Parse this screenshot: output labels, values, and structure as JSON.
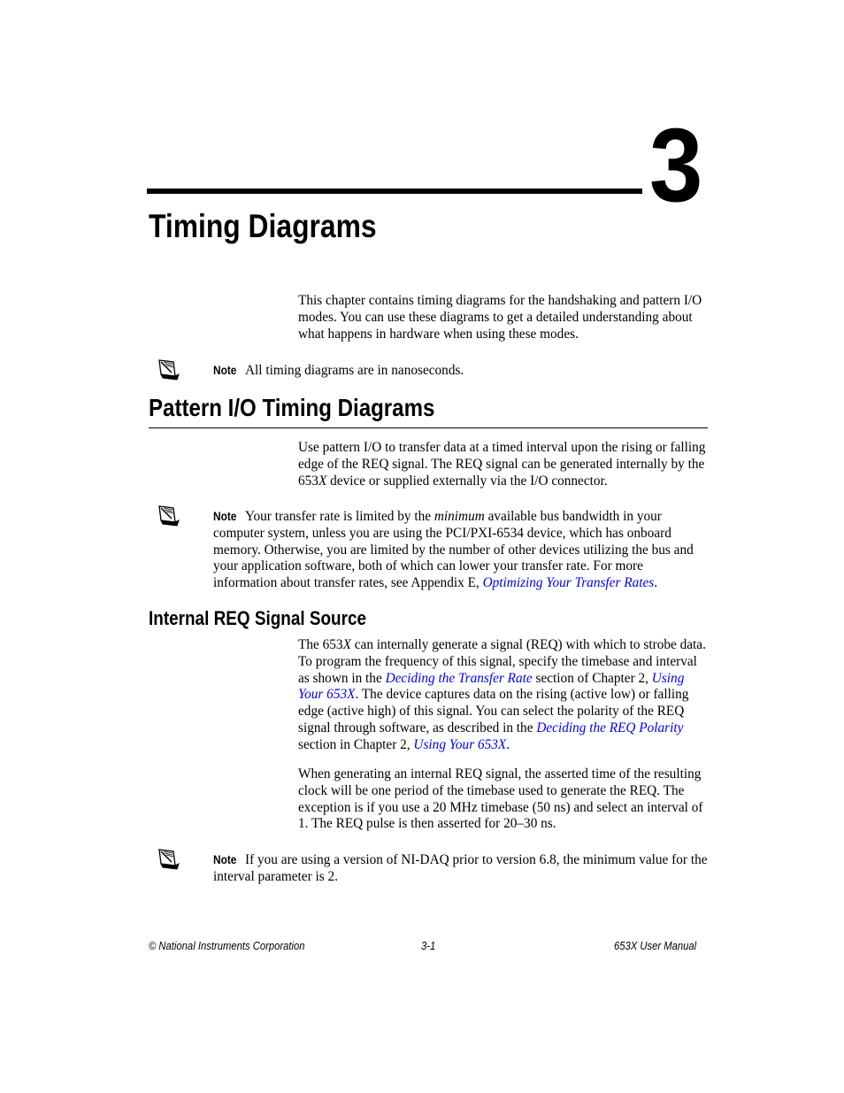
{
  "chapter": {
    "number": "3",
    "title": "Timing Diagrams"
  },
  "intro": {
    "paragraph": "This chapter contains timing diagrams for the handshaking and pattern I/O modes. You can use these diagrams to get a detailed understanding about what happens in hardware when using these modes."
  },
  "note_label": "Note",
  "notes": [
    {
      "icon": "note-pencil-icon",
      "text": "All timing diagrams are in nanoseconds."
    },
    {
      "icon": "note-pencil-icon",
      "text_before_emph": "Your transfer rate is limited by the ",
      "emph": "minimum",
      "text_after_emph": " available bus bandwidth in your computer system, unless you are using the PCI/PXI-6534 device, which has onboard memory. Otherwise, you are limited by the number of other devices utilizing the bus and your application software, both of which can lower your transfer rate. For more information about transfer rates, see Appendix E, ",
      "link": "Optimizing Your Transfer Rates",
      "text_end": "."
    },
    {
      "icon": "note-pencil-icon",
      "text": "If you are using a version of NI-DAQ prior to version 6.8, the minimum value for the interval parameter is 2."
    }
  ],
  "section_pattern_io": {
    "heading": "Pattern I/O Timing Diagrams",
    "p1_a": "Use pattern I/O to transfer data at a timed interval upon the rising or falling edge of the REQ signal. The REQ signal can be generated internally by the 653",
    "p1_x": "X",
    "p1_b": " device or supplied externally via the I/O connector."
  },
  "section_internal_req": {
    "heading": "Internal REQ Signal Source",
    "p1_a": "The 653",
    "p1_x": "X",
    "p1_b": " can internally generate a signal (REQ) with which to strobe data. To program the frequency of this signal, specify the timebase and interval as shown in the ",
    "p1_link1": "Deciding the Transfer Rate",
    "p1_c": " section of Chapter 2, ",
    "p1_link2": "Using Your 653X",
    "p1_d": ". The device captures data on the rising (active low) or falling edge (active high) of this signal. You can select the polarity of the REQ signal through software, as described in the ",
    "p1_link3": "Deciding the REQ Polarity",
    "p1_e": " section in Chapter 2, ",
    "p1_link4": "Using Your 653X",
    "p1_f": ".",
    "p2": "When generating an internal REQ signal, the asserted time of the resulting clock will be one period of the timebase used to generate the REQ. The exception is if you use a 20 MHz timebase (50 ns) and select an interval of 1. The REQ pulse is then asserted for 20–30 ns."
  },
  "footer": {
    "left": "© National Instruments Corporation",
    "center": "3-1",
    "right": "653X User Manual"
  },
  "colors": {
    "link": "#0000ee",
    "text": "#000000"
  }
}
